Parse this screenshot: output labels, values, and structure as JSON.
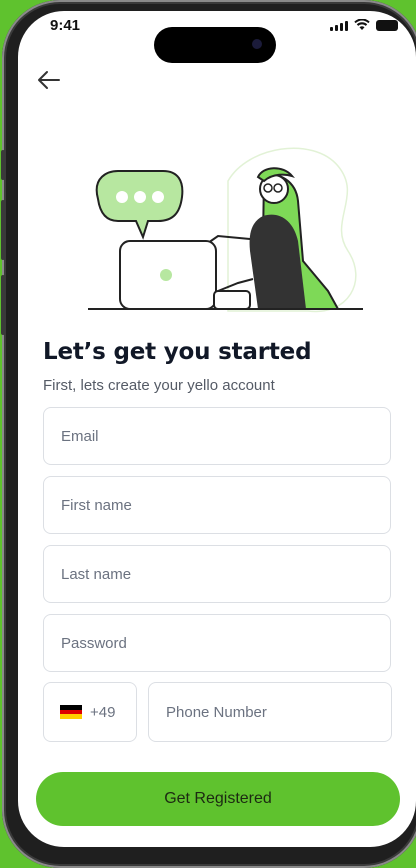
{
  "status_bar": {
    "time": "9:41"
  },
  "colors": {
    "accent": "#5fc22e",
    "background": "#5fc22e",
    "text": "#111827"
  },
  "header": {
    "back_icon": "arrow-left-icon"
  },
  "illustration": {
    "description_icon": "person-laptop-chat-illustration"
  },
  "title": "Let’s get you started",
  "subtitle": "First, lets create your yello account",
  "form": {
    "email": {
      "placeholder": "Email",
      "value": ""
    },
    "first_name": {
      "placeholder": "First name",
      "value": ""
    },
    "last_name": {
      "placeholder": "Last name",
      "value": ""
    },
    "password": {
      "placeholder": "Password",
      "value": ""
    },
    "country_code": {
      "flag_icon": "germany-flag-icon",
      "code": "+49"
    },
    "phone": {
      "placeholder": "Phone Number",
      "value": ""
    }
  },
  "submit_label": "Get Registered"
}
